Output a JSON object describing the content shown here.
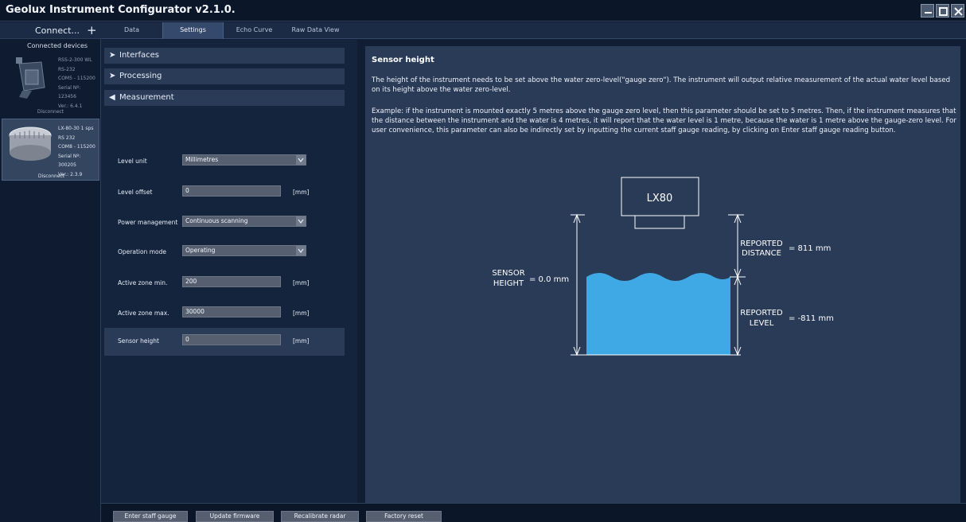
{
  "app": {
    "title": "Geolux Instrument Configurator v2.1.0."
  },
  "sidebar": {
    "connect_label": "Connect...",
    "connect_plus": "+",
    "devices_heading": "Connected devices",
    "devices": [
      {
        "lines": [
          "RSS-2-300 WL",
          "RS-232",
          "COM5 - 115200",
          "Serial Nº: 123456",
          "Ver.: 6.4.1"
        ],
        "disconnect": "Disconnect"
      },
      {
        "lines": [
          "LX-80-30 1 sps",
          "RS 232",
          "COM8 - 115200",
          "Serial Nº: 300205",
          "Ver.: 2.3.9"
        ],
        "disconnect": "Disconnect"
      }
    ]
  },
  "tabs": [
    "Data",
    "Settings",
    "Echo Curve",
    "Raw Data View"
  ],
  "sections": [
    {
      "title": "Interfaces",
      "chevron": "➤"
    },
    {
      "title": "Processing",
      "chevron": "➤"
    },
    {
      "title": "Measurement",
      "chevron": "◀"
    }
  ],
  "fields": [
    {
      "label": "Level unit",
      "value": "Millimetres",
      "unit": ""
    },
    {
      "label": "Level offset",
      "value": "0",
      "unit": "[mm]"
    },
    {
      "label": "Power management",
      "value": "Continuous scanning",
      "unit": ""
    },
    {
      "label": "Operation mode",
      "value": "Operating",
      "unit": ""
    },
    {
      "label": "Active zone min.",
      "value": "200",
      "unit": "[mm]"
    },
    {
      "label": "Active zone max.",
      "value": "30000",
      "unit": "[mm]"
    },
    {
      "label": "Sensor height",
      "value": "0",
      "unit": "[mm]"
    }
  ],
  "help": {
    "title": "Sensor height",
    "p1": "The height of the instrument needs to be set above the water zero-level(\"gauge zero\"). The instrument will output relative measurement of the actual water level based on its height above the water zero-level.",
    "p2": "Example: if the instrument is mounted exactly 5 metres above the gauge zero level, then this parameter should be set to 5 metres. Then, if the instrument measures that the distance between the instrument and the water is 4 metres, it will report that the water level is 1 metre, because the water is 1 metre above the gauge-zero level. For user convenience, this parameter can also be indirectly set by inputting the current staff gauge reading, by clicking on Enter staff gauge reading button."
  },
  "diagram": {
    "device": "LX80",
    "sensor_height_l1": "SENSOR",
    "sensor_height_l2": "HEIGHT",
    "sensor_height_value": "= 0.0 mm",
    "distance_l1": "REPORTED",
    "distance_l2": "DISTANCE",
    "distance_value": "= 811 mm",
    "level_l1": "REPORTED",
    "level_l2": "LEVEL",
    "level_value": "= -811 mm",
    "water_color": "#3fa9e6"
  },
  "bottom_buttons": [
    "Enter staff gauge reading",
    "Update firmware",
    "Recalibrate radar",
    "Factory reset"
  ]
}
